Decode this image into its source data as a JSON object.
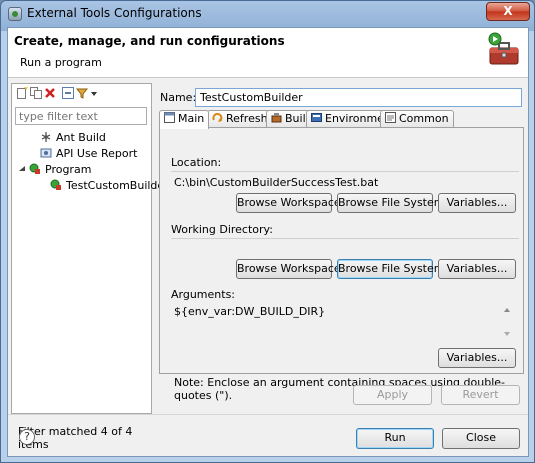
{
  "window": {
    "title": "External Tools Configurations",
    "close_label": "X"
  },
  "header": {
    "title": "Create, manage, and run configurations",
    "subtitle": "Run a program",
    "icon": "toolbox-icon"
  },
  "left": {
    "filter_placeholder": "type filter text",
    "tree": [
      {
        "label": "Ant Build",
        "icon": "ant-icon"
      },
      {
        "label": "API Use Report",
        "icon": "api-report-icon"
      },
      {
        "label": "Program",
        "icon": "program-icon",
        "expanded": true
      },
      {
        "label": "TestCustomBuilder",
        "icon": "program-config-icon"
      }
    ],
    "status": "Filter matched 4 of 4 items"
  },
  "main": {
    "name_label": "Name:",
    "name_value": "TestCustomBuilder",
    "tabs": [
      {
        "label": "Main",
        "active": true
      },
      {
        "label": "Refresh"
      },
      {
        "label": "Build"
      },
      {
        "label": "Environment"
      },
      {
        "label": "Common"
      }
    ],
    "location_label": "Location:",
    "location_value": "C:\\bin\\CustomBuilderSuccessTest.bat",
    "working_dir_label": "Working Directory:",
    "arguments_label": "Arguments:",
    "arguments_value": "${env_var:DW_BUILD_DIR}",
    "browse_workspace": "Browse Workspace...",
    "browse_file_system": "Browse File System...",
    "variables": "Variables...",
    "note": "Note: Enclose an argument containing spaces using double-quotes (\")."
  },
  "buttons": {
    "apply": "Apply",
    "revert": "Revert",
    "run": "Run",
    "close": "Close",
    "help": "?"
  },
  "colors": {
    "title_bar": "#a9c4e4",
    "close_red": "#c2331b",
    "focus_blue": "#3c7fb1"
  }
}
